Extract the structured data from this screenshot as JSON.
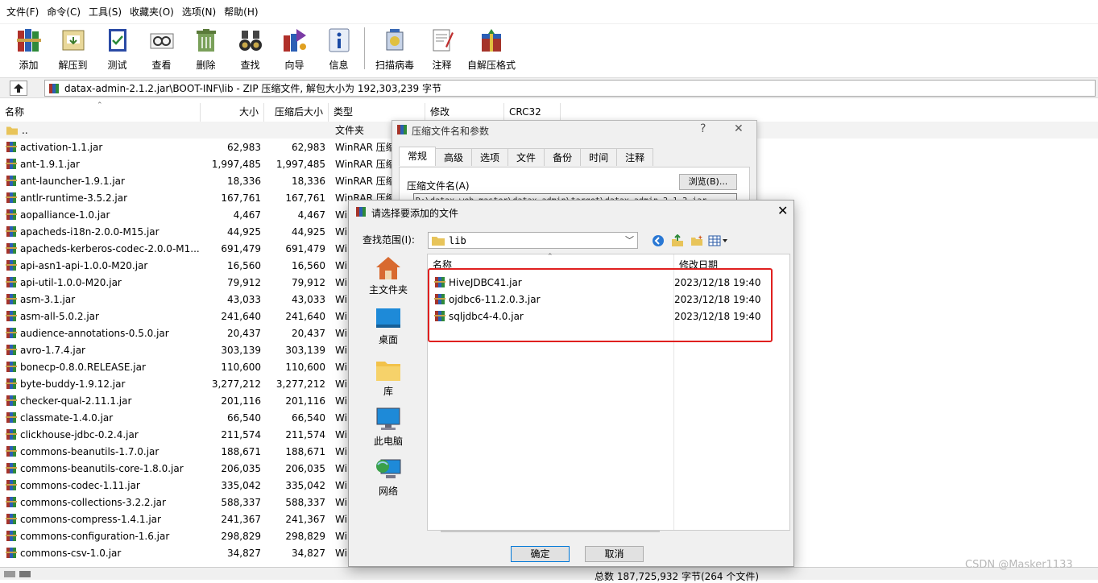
{
  "menu": [
    "文件(F)",
    "命令(C)",
    "工具(S)",
    "收藏夹(O)",
    "选项(N)",
    "帮助(H)"
  ],
  "toolbar": {
    "group1": [
      {
        "label": "添加",
        "icon": "books-add-icon"
      },
      {
        "label": "解压到",
        "icon": "extract-to-icon"
      },
      {
        "label": "测试",
        "icon": "test-icon"
      },
      {
        "label": "查看",
        "icon": "view-icon"
      },
      {
        "label": "删除",
        "icon": "delete-icon"
      },
      {
        "label": "查找",
        "icon": "binoculars-icon"
      },
      {
        "label": "向导",
        "icon": "wizard-icon"
      },
      {
        "label": "信息",
        "icon": "info-icon"
      }
    ],
    "group2": [
      {
        "label": "扫描病毒",
        "icon": "virus-scan-icon"
      },
      {
        "label": "注释",
        "icon": "comment-icon"
      },
      {
        "label": "自解压格式",
        "icon": "sfx-icon"
      }
    ]
  },
  "address": {
    "path": "datax-admin-2.1.2.jar\\BOOT-INF\\lib - ZIP 压缩文件, 解包大小为 192,303,239 字节"
  },
  "columns": {
    "name": "名称",
    "size": "大小",
    "packed": "压缩后大小",
    "type": "类型",
    "modified": "修改",
    "crc": "CRC32"
  },
  "parent_row": {
    "name": "..",
    "type": "文件夹"
  },
  "type_prefix": "WinRAR 压缩",
  "type_short": "Wi",
  "files": [
    {
      "name": "activation-1.1.jar",
      "size": "62,983",
      "packed": "62,983"
    },
    {
      "name": "ant-1.9.1.jar",
      "size": "1,997,485",
      "packed": "1,997,485"
    },
    {
      "name": "ant-launcher-1.9.1.jar",
      "size": "18,336",
      "packed": "18,336"
    },
    {
      "name": "antlr-runtime-3.5.2.jar",
      "size": "167,761",
      "packed": "167,761"
    },
    {
      "name": "aopalliance-1.0.jar",
      "size": "4,467",
      "packed": "4,467"
    },
    {
      "name": "apacheds-i18n-2.0.0-M15.jar",
      "size": "44,925",
      "packed": "44,925"
    },
    {
      "name": "apacheds-kerberos-codec-2.0.0-M1...",
      "size": "691,479",
      "packed": "691,479"
    },
    {
      "name": "api-asn1-api-1.0.0-M20.jar",
      "size": "16,560",
      "packed": "16,560"
    },
    {
      "name": "api-util-1.0.0-M20.jar",
      "size": "79,912",
      "packed": "79,912"
    },
    {
      "name": "asm-3.1.jar",
      "size": "43,033",
      "packed": "43,033"
    },
    {
      "name": "asm-all-5.0.2.jar",
      "size": "241,640",
      "packed": "241,640"
    },
    {
      "name": "audience-annotations-0.5.0.jar",
      "size": "20,437",
      "packed": "20,437"
    },
    {
      "name": "avro-1.7.4.jar",
      "size": "303,139",
      "packed": "303,139"
    },
    {
      "name": "bonecp-0.8.0.RELEASE.jar",
      "size": "110,600",
      "packed": "110,600"
    },
    {
      "name": "byte-buddy-1.9.12.jar",
      "size": "3,277,212",
      "packed": "3,277,212"
    },
    {
      "name": "checker-qual-2.11.1.jar",
      "size": "201,116",
      "packed": "201,116"
    },
    {
      "name": "classmate-1.4.0.jar",
      "size": "66,540",
      "packed": "66,540"
    },
    {
      "name": "clickhouse-jdbc-0.2.4.jar",
      "size": "211,574",
      "packed": "211,574"
    },
    {
      "name": "commons-beanutils-1.7.0.jar",
      "size": "188,671",
      "packed": "188,671"
    },
    {
      "name": "commons-beanutils-core-1.8.0.jar",
      "size": "206,035",
      "packed": "206,035"
    },
    {
      "name": "commons-codec-1.11.jar",
      "size": "335,042",
      "packed": "335,042"
    },
    {
      "name": "commons-collections-3.2.2.jar",
      "size": "588,337",
      "packed": "588,337"
    },
    {
      "name": "commons-compress-1.4.1.jar",
      "size": "241,367",
      "packed": "241,367"
    },
    {
      "name": "commons-configuration-1.6.jar",
      "size": "298,829",
      "packed": "298,829"
    },
    {
      "name": "commons-csv-1.0.jar",
      "size": "34,827",
      "packed": "34,827"
    }
  ],
  "status": "总数 187,725,932 字节(264 个文件)",
  "watermark": "CSDN @Masker1133",
  "archive_dialog": {
    "title": "压缩文件名和参数",
    "help": "?",
    "close": "✕",
    "tabs": [
      "常规",
      "高级",
      "选项",
      "文件",
      "备份",
      "时间",
      "注释"
    ],
    "archive_name_label": "压缩文件名(A)",
    "browse": "浏览(B)...",
    "archive_path": "D:\\datax-web-master\\datax-admin\\target\\datax-admin-2.1.2.jar"
  },
  "select_dialog": {
    "title": "请选择要添加的文件",
    "close": "✕",
    "look_in_label": "查找范围(I):",
    "look_in_value": "lib",
    "places": [
      "主文件夹",
      "桌面",
      "库",
      "此电脑",
      "网络"
    ],
    "col_name": "名称",
    "col_date": "修改日期",
    "files": [
      {
        "name": "HiveJDBC41.jar",
        "date": "2023/12/18 19:40"
      },
      {
        "name": "ojdbc6-11.2.0.3.jar",
        "date": "2023/12/18 19:40"
      },
      {
        "name": "sqljdbc4-4.0.jar",
        "date": "2023/12/18 19:40"
      }
    ],
    "ok": "确定",
    "cancel": "取消"
  },
  "colors": {
    "highlight": "#e0201f",
    "accent": "#0078d7"
  }
}
